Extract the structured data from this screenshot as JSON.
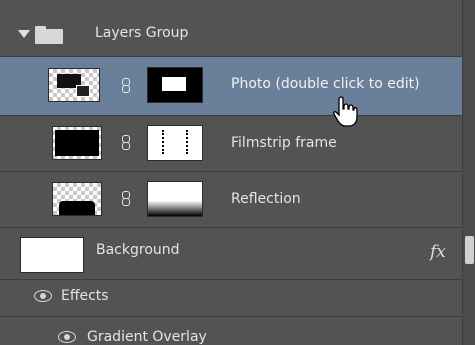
{
  "layers_panel": {
    "group": {
      "label": "Layers Group",
      "expanded": true
    },
    "layers": [
      {
        "id": "photo",
        "label": "Photo (double click to edit)",
        "selected": true
      },
      {
        "id": "filmstrip",
        "label": "Filmstrip frame",
        "selected": false
      },
      {
        "id": "reflection",
        "label": "Reflection",
        "selected": false
      }
    ],
    "background": {
      "label": "Background",
      "fx_label": "fx"
    },
    "effects": {
      "label": "Effects",
      "items": [
        {
          "label": "Gradient Overlay"
        }
      ]
    }
  },
  "colors": {
    "panel_bg": "#535353",
    "selection": "#6a7f99",
    "text": "#e4e4e4",
    "separator": "#3d3d3d"
  },
  "icons": [
    "disclosure-triangle-icon",
    "folder-icon",
    "link-icon",
    "eye-icon",
    "fx-icon",
    "hand-cursor-icon"
  ]
}
